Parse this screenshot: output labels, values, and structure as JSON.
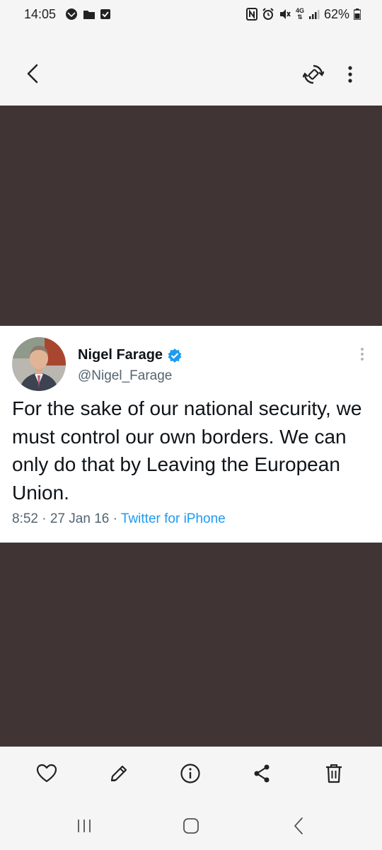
{
  "status_bar": {
    "time": "14:05",
    "network": "4G",
    "battery": "62%"
  },
  "tweet": {
    "author_name": "Nigel Farage",
    "author_handle": "@Nigel_Farage",
    "text": "For the sake of our national security, we must control our own borders. We can only do that by Leaving the European Union.",
    "time": "8:52",
    "separator": "·",
    "date": "27 Jan 16",
    "source": "Twitter for iPhone"
  },
  "colors": {
    "viewer_background": "#403434",
    "link_blue": "#1d9bf0",
    "secondary_text": "#536471"
  },
  "icons": {
    "top_bar": [
      "back-icon",
      "rotate-icon",
      "more-vertical-icon"
    ],
    "actions": [
      "heart-icon",
      "pencil-icon",
      "info-icon",
      "share-icon",
      "trash-icon"
    ],
    "nav": [
      "recents-icon",
      "home-icon",
      "back-icon"
    ]
  }
}
